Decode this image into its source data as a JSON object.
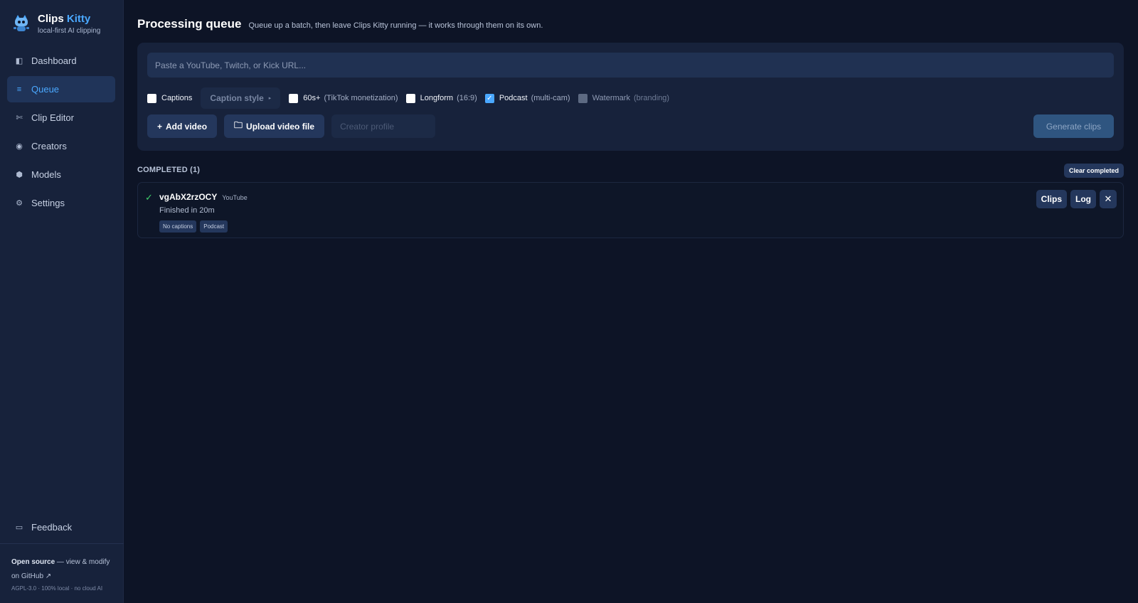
{
  "app": {
    "name_part1": "Clips",
    "name_part2": "Kitty",
    "tagline": "local-first AI clipping",
    "logo_icon": "robot-cat-icon",
    "accent_color": "#4aa8ff"
  },
  "sidebar": {
    "items": [
      {
        "label": "Dashboard",
        "icon": "panel-icon",
        "glyph": "◧",
        "active": false
      },
      {
        "label": "Queue",
        "icon": "list-icon",
        "glyph": "≡",
        "active": true
      },
      {
        "label": "Clip Editor",
        "icon": "scissors-icon",
        "glyph": "✄",
        "active": false
      },
      {
        "label": "Creators",
        "icon": "target-icon",
        "glyph": "◉",
        "active": false
      },
      {
        "label": "Models",
        "icon": "hexagon-icon",
        "glyph": "⬢",
        "active": false
      },
      {
        "label": "Settings",
        "icon": "gear-icon",
        "glyph": "⚙",
        "active": false
      }
    ],
    "feedback": {
      "label": "Feedback",
      "icon": "chat-icon",
      "glyph": "▭"
    },
    "footer": {
      "open_source": "Open source",
      "link_text_1": " — view & modify",
      "link_text_2": "on GitHub ↗",
      "meta": "AGPL-3.0 · 100% local · no cloud AI"
    }
  },
  "header": {
    "title": "Processing queue",
    "subtitle": "Queue up a batch, then leave Clips Kitty running — it works through them on its own."
  },
  "form": {
    "url_placeholder": "Paste a YouTube, Twitch, or Kick URL...",
    "url_value": "",
    "options": {
      "captions": {
        "label": "Captions",
        "checked": false
      },
      "caption_style": {
        "label": "Caption style",
        "arrow": "▸"
      },
      "sixty_plus": {
        "label": "60s+",
        "hint": "(TikTok monetization)",
        "checked": false
      },
      "longform": {
        "label": "Longform",
        "hint": "(16:9)",
        "checked": false
      },
      "podcast": {
        "label": "Podcast",
        "hint": "(multi-cam)",
        "checked": true
      },
      "watermark": {
        "label": "Watermark",
        "hint": "(branding)",
        "checked": false,
        "disabled": true
      }
    },
    "add_video": {
      "icon": "plus-icon",
      "glyph": "+",
      "label": "Add video"
    },
    "upload_file": {
      "icon": "folder-icon",
      "glyph": "🗀",
      "label": "Upload video file"
    },
    "creator_profile_placeholder": "Creator profile",
    "generate_label": "Generate clips"
  },
  "completed": {
    "heading": "COMPLETED (1)",
    "clear_label": "Clear completed",
    "jobs": [
      {
        "status_icon": "check-icon",
        "status_glyph": "✓",
        "id": "vgAbX2rzOCY",
        "source": "YouTube",
        "status_text": "Finished in 20m",
        "tags": [
          "No captions",
          "Podcast"
        ],
        "actions": {
          "clips": "Clips",
          "log": "Log",
          "close_glyph": "✕"
        }
      }
    ]
  },
  "colors": {
    "background": "#0d1426",
    "sidebar": "#17223b",
    "panel": "#17223b",
    "button": "#24375c",
    "success": "#3ecf6b"
  }
}
